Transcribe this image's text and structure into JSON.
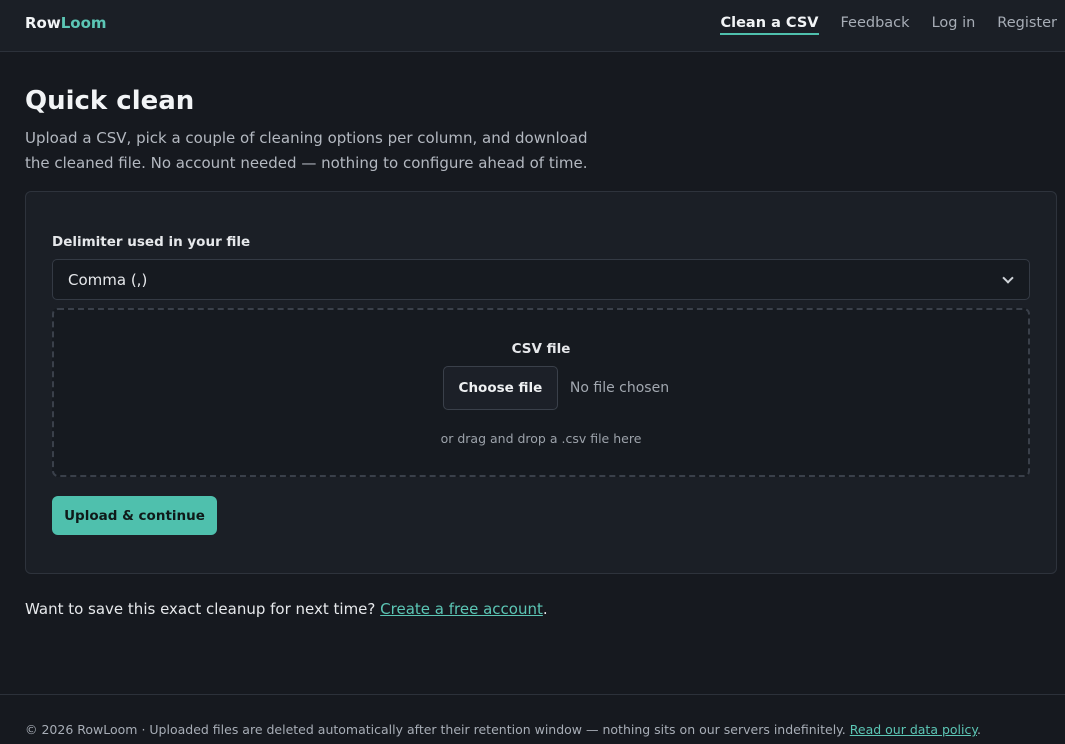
{
  "brand": {
    "part1": "Row",
    "part2": "Loom",
    "accent_color": "#5cc6b5"
  },
  "nav": {
    "items": [
      {
        "label": "Clean a CSV",
        "active": true
      },
      {
        "label": "Feedback"
      },
      {
        "label": "Log in"
      },
      {
        "label": "Register"
      }
    ]
  },
  "main": {
    "title": "Quick clean",
    "intro": "Upload a CSV, pick a couple of cleaning options per column, and download the cleaned file. No account needed — nothing to configure ahead of time."
  },
  "form": {
    "delimiter_label": "Delimiter used in your file",
    "delimiter_selected": "Comma (,)",
    "csv_label": "CSV file",
    "choose_file_label": "Choose file",
    "no_file_text": "No file chosen",
    "drop_hint": "or drag and drop a .csv file here",
    "submit_label": "Upload & continue",
    "submit_color": "#4fc0ad"
  },
  "save_prompt": {
    "text": "Want to save this exact cleanup for next time?",
    "link_text": "Create a free account",
    "trailing": "."
  },
  "footer": {
    "text": "© 2026 RowLoom · Uploaded files are deleted automatically after their retention window — nothing sits on our servers indefinitely.",
    "link_text": "Read our data policy",
    "trailing": "."
  },
  "colors": {
    "background": "#16191f",
    "card": "#1b1f26",
    "accent": "#4fc0ad"
  }
}
